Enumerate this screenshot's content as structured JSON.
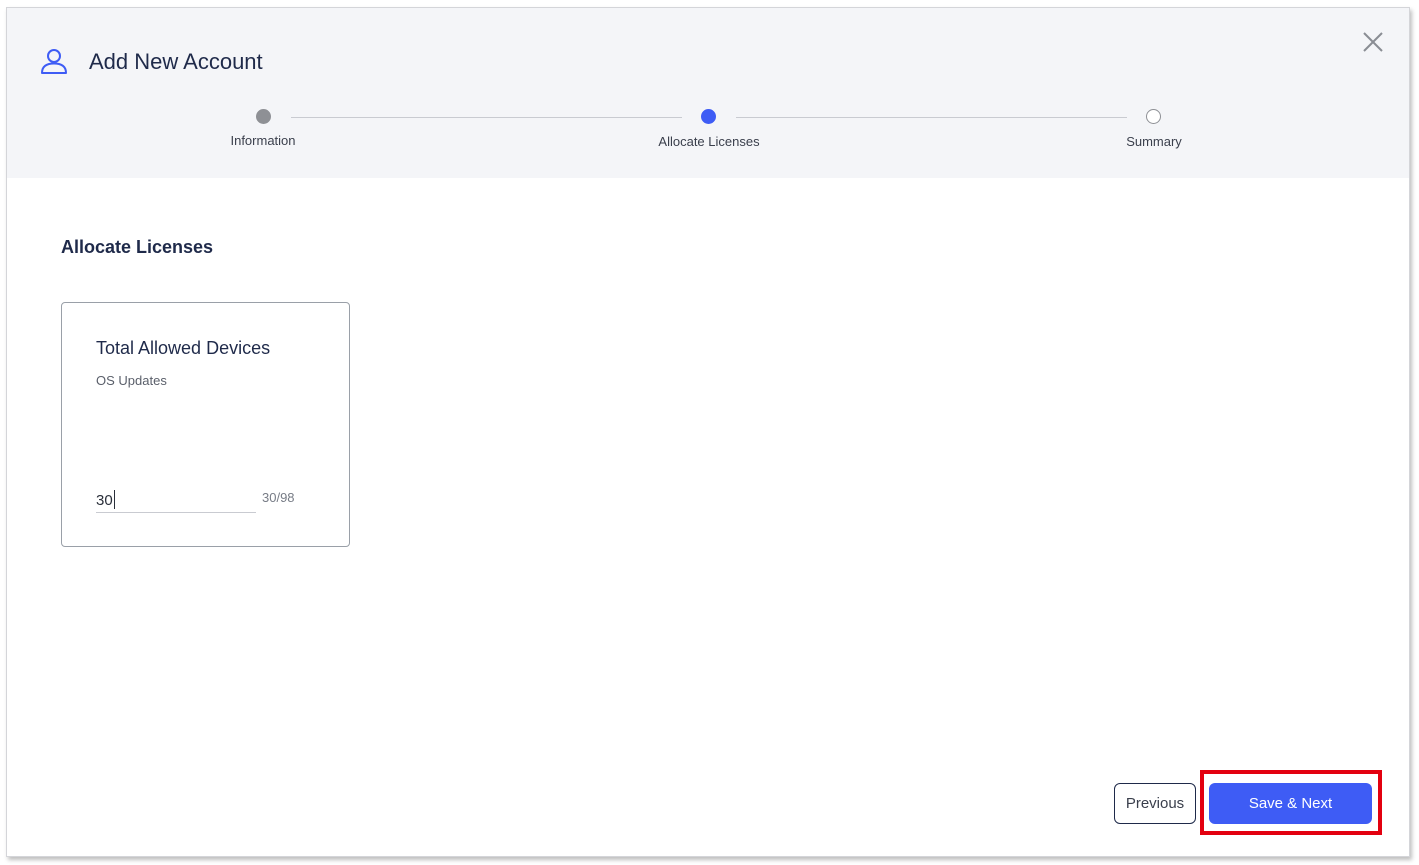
{
  "dialog": {
    "title": "Add New Account",
    "title_icon": "user-icon",
    "close_icon": "close-icon"
  },
  "stepper": {
    "steps": [
      {
        "label": "Information",
        "state": "complete"
      },
      {
        "label": "Allocate Licenses",
        "state": "active"
      },
      {
        "label": "Summary",
        "state": "pending"
      }
    ]
  },
  "main": {
    "section_title": "Allocate Licenses",
    "card": {
      "title": "Total Allowed Devices",
      "subtitle": "OS Updates",
      "value": "30",
      "limit": "30/98"
    }
  },
  "footer": {
    "previous_label": "Previous",
    "next_label": "Save & Next"
  },
  "colors": {
    "accent": "#3e5cf5",
    "highlight": "#e3000f",
    "header_bg": "#f4f5f8",
    "text_dark": "#1f2a4a"
  }
}
